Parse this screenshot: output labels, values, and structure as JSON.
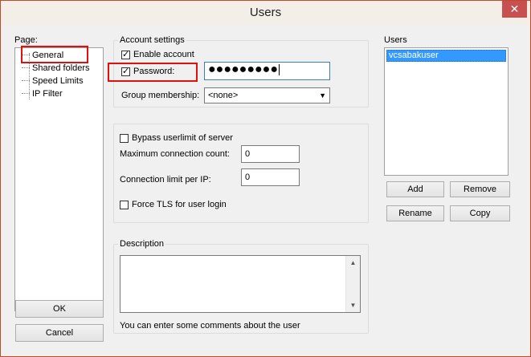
{
  "window": {
    "title": "Users",
    "close_glyph": "✕"
  },
  "page_section": {
    "label": "Page:",
    "items": [
      "General",
      "Shared folders",
      "Speed Limits",
      "IP Filter"
    ]
  },
  "account": {
    "group_title": "Account settings",
    "enable_account_label": "Enable account",
    "enable_account_checked": true,
    "password_label": "Password:",
    "password_checked": true,
    "password_mask": "●●●●●●●●●",
    "group_membership_label": "Group membership:",
    "group_membership_value": "<none>"
  },
  "limits": {
    "bypass_label": "Bypass userlimit of server",
    "bypass_checked": false,
    "max_conn_label": "Maximum connection count:",
    "max_conn_value": "0",
    "conn_limit_ip_label": "Connection limit per IP:",
    "conn_limit_ip_value": "0",
    "force_tls_label": "Force TLS for user login",
    "force_tls_checked": false
  },
  "users": {
    "label": "Users",
    "items": [
      "vcsabakuser"
    ],
    "add_label": "Add",
    "remove_label": "Remove",
    "rename_label": "Rename",
    "copy_label": "Copy"
  },
  "description": {
    "group_title": "Description",
    "hint": "You can enter some comments about the user"
  },
  "footer": {
    "ok_label": "OK",
    "cancel_label": "Cancel"
  },
  "colors": {
    "highlight_box": "#e01010",
    "selection": "#3399ff",
    "close_button": "#c75050"
  }
}
